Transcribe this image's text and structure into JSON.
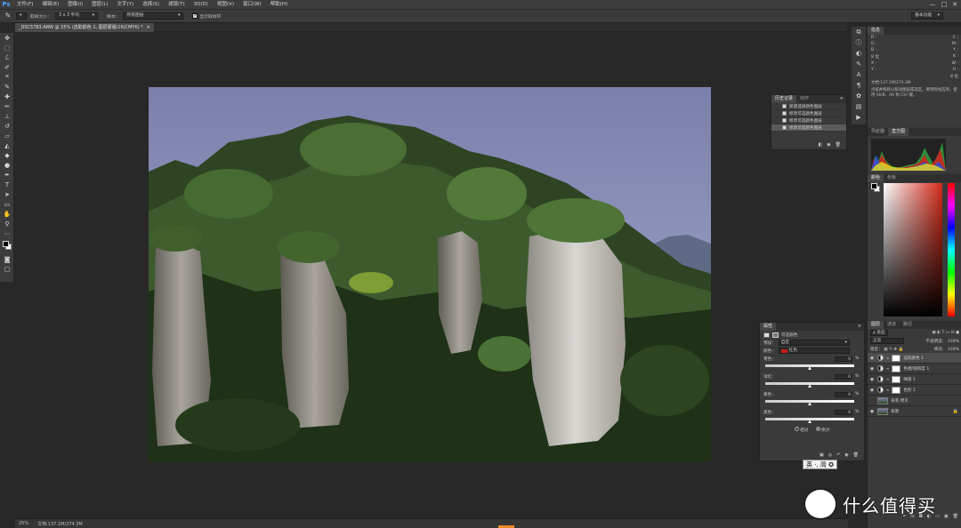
{
  "app": {
    "logo": "Ps",
    "menus": [
      "文件(F)",
      "编辑(E)",
      "图像(I)",
      "图层(L)",
      "文字(Y)",
      "选择(S)",
      "滤镜(T)",
      "3D(D)",
      "视图(V)",
      "窗口(W)",
      "帮助(H)"
    ],
    "window_controls": [
      "—",
      "□",
      "✕"
    ]
  },
  "options_bar": {
    "sample_size_label": "取样大小：",
    "sample_size_value": "3 x 3 平均",
    "sample_label": "样本：",
    "sample_value": "所有图层",
    "show_ring_label": "显示取样环",
    "show_ring_checked": true,
    "workspace": "基本功能"
  },
  "document": {
    "tab_title": "_DSC5783.ARW @ 25% (选取颜色 1, 图层蒙版/16/CMYK) *",
    "tab_close": "×"
  },
  "statusbar": {
    "zoom": "25%",
    "doc_size": "文档:137.1M/274.3M"
  },
  "info_panel": {
    "tabs": [
      "信息"
    ],
    "c_label": "C :",
    "m_label": "M :",
    "y_label": "Y :",
    "k_label": "K :",
    "r_label": "R :",
    "g_label": "G :",
    "b_label": "B :",
    "bit_left": "8 位",
    "bit_right": "8 位",
    "x_label": "X :",
    "y2_label": "Y :",
    "w_label": "W :",
    "h_label": "H :",
    "doc_info": "文档:137.1M/274.3M",
    "hint": "点按并拖移以移动图层或选区。要用附加选项，使用 Shift、Alt 和 Ctrl 键。"
  },
  "histogram_panel": {
    "tabs": [
      "导航器",
      "直方图"
    ],
    "warning_icon": "warning-icon"
  },
  "color_panel": {
    "tabs": [
      "颜色",
      "色板"
    ],
    "hue_color": "#d42a1a"
  },
  "layers_panel": {
    "tabs": [
      "图层",
      "通道",
      "路径"
    ],
    "kind_label": "ρ 类型",
    "blend_mode": "正常",
    "opacity_label": "不透明度：",
    "opacity_value": "100%",
    "lock_label": "锁定：",
    "fill_label": "填充：",
    "fill_value": "100%",
    "layers": [
      {
        "name": "选取颜色 1",
        "type": "adjustment",
        "selected": true
      },
      {
        "name": "色相/饱和度 1",
        "type": "adjustment",
        "selected": false
      },
      {
        "name": "阈值 1",
        "type": "adjustment",
        "selected": false
      },
      {
        "name": "色阶 1",
        "type": "adjustment",
        "selected": false
      },
      {
        "name": "背景 拷贝",
        "type": "image",
        "selected": false
      },
      {
        "name": "背景",
        "type": "image",
        "selected": false
      }
    ],
    "footer_icons": [
      "fx",
      "◘",
      "◐",
      "▭",
      "▣",
      "🗑"
    ]
  },
  "history_panel": {
    "tabs": [
      "历史记录",
      "动作"
    ],
    "items": [
      {
        "label": "新建选择颜色图层",
        "selected": false
      },
      {
        "label": "修改可选颜色图层",
        "selected": false
      },
      {
        "label": "修改可选颜色图层",
        "selected": false
      },
      {
        "label": "修改可选颜色图层",
        "selected": true
      }
    ],
    "footer_icons": [
      "◧",
      "◉",
      "🗑"
    ]
  },
  "properties_panel": {
    "tabs": [
      "属性"
    ],
    "title": "可选颜色",
    "preset_label": "预设：",
    "preset_value": "自定",
    "colors_label": "颜色：",
    "colors_value": "红色",
    "colors_swatch": "#c4201b",
    "sliders": [
      {
        "label": "青色：",
        "value": "0"
      },
      {
        "label": "洋红：",
        "value": "0"
      },
      {
        "label": "黄色：",
        "value": "0"
      },
      {
        "label": "黑色：",
        "value": "0"
      }
    ],
    "pct": "%",
    "relative_label": "相对",
    "absolute_label": "绝对",
    "method": "absolute",
    "footer_icons": [
      "▣",
      "◎",
      "↶",
      "◉",
      "🗑"
    ]
  },
  "ime": {
    "text": "英 ·, 简 ✪"
  },
  "watermark": {
    "text": "什么值得买"
  }
}
